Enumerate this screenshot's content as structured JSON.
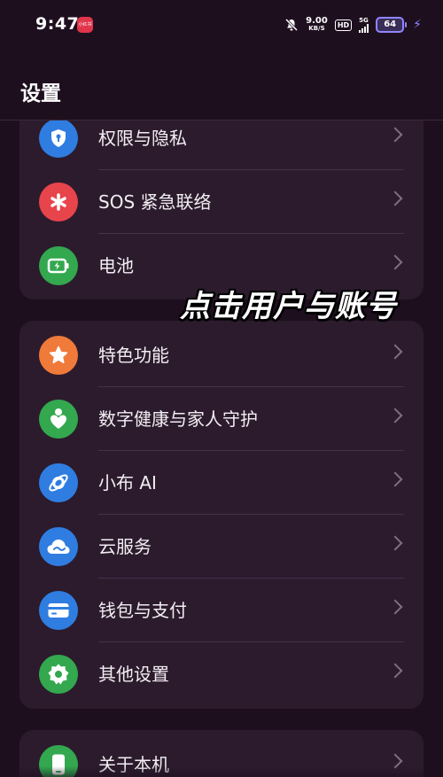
{
  "status_bar": {
    "time": "9:47",
    "app_badge": "小红书",
    "speed_value": "9.00",
    "speed_unit": "KB/S",
    "hd": "HD",
    "network": "5G",
    "battery": "64"
  },
  "header": {
    "title": "设置"
  },
  "overlay": {
    "caption": "点击用户与账号"
  },
  "groups": [
    {
      "items": [
        {
          "label": "权限与隐私",
          "icon": "shield-lock-icon",
          "color": "#2f7de1"
        },
        {
          "label": "SOS 紧急联络",
          "icon": "asterisk-icon",
          "color": "#e8444b"
        },
        {
          "label": "电池",
          "icon": "battery-icon",
          "color": "#33a84f"
        }
      ]
    },
    {
      "items": [
        {
          "label": "特色功能",
          "icon": "star-icon",
          "color": "#f07a3a"
        },
        {
          "label": "数字健康与家人守护",
          "icon": "family-care-icon",
          "color": "#33a84f"
        },
        {
          "label": "小布 AI",
          "icon": "ai-assistant-icon",
          "color": "#2f7de1"
        },
        {
          "label": "云服务",
          "icon": "cloud-icon",
          "color": "#2f7de1"
        },
        {
          "label": "钱包与支付",
          "icon": "wallet-card-icon",
          "color": "#2f7de1"
        },
        {
          "label": "其他设置",
          "icon": "gear-icon",
          "color": "#33a84f"
        }
      ]
    },
    {
      "items": [
        {
          "label": "关于本机",
          "icon": "phone-icon",
          "color": "#33a84f"
        }
      ]
    }
  ]
}
